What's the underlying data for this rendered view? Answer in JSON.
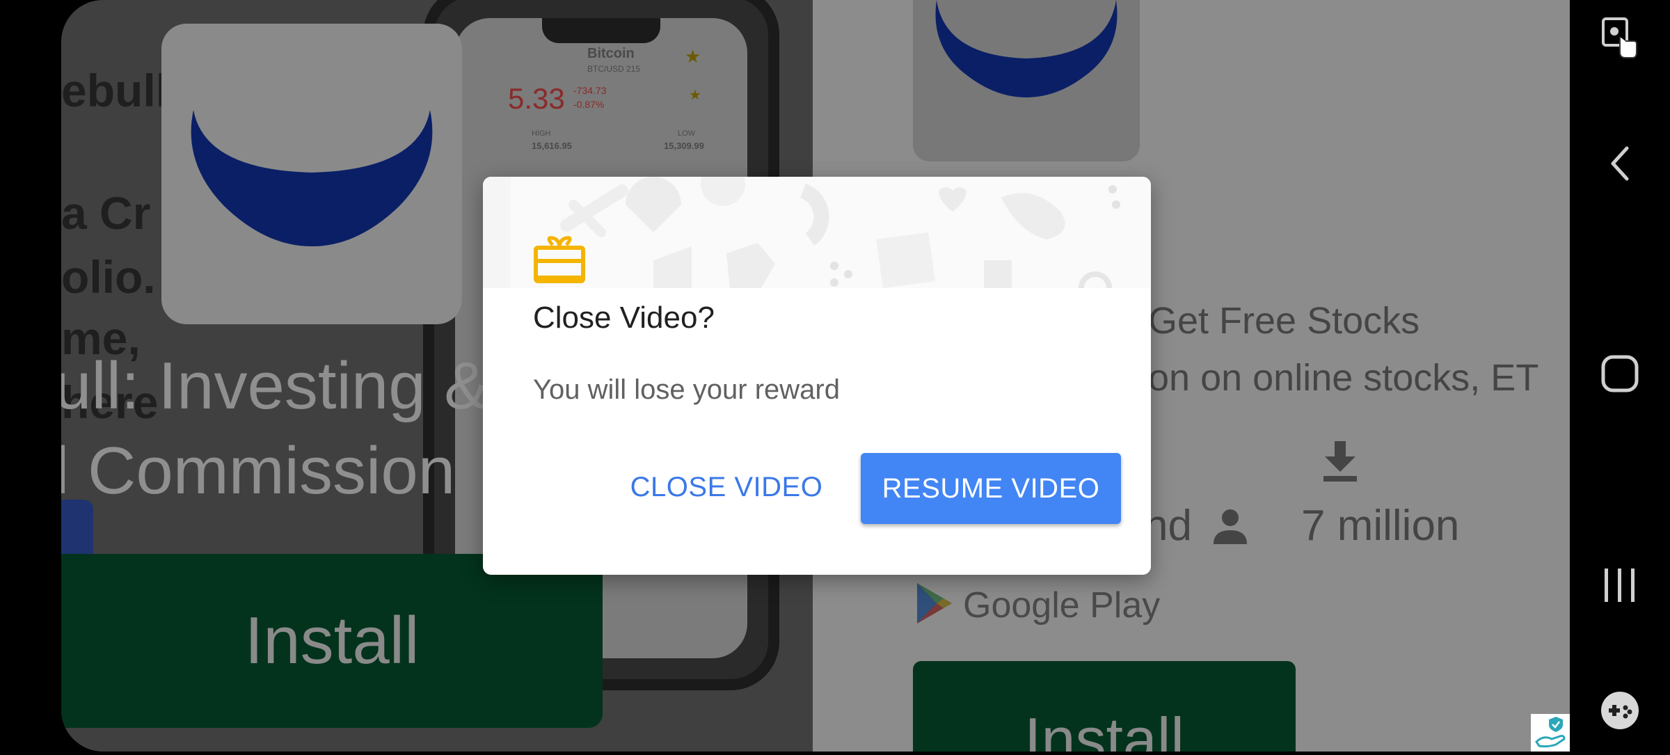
{
  "left_ad": {
    "bg_text_lines": [
      "ebull",
      "a Cr",
      "olio.",
      "me,",
      "here"
    ],
    "title_line1": "ull: Investing &",
    "title_line2": "l Commission",
    "install_label": "Install",
    "phone": {
      "coin_name": "Bitcoin",
      "coin_sub": "BTC/USD 215",
      "price": "5.33",
      "change_abs": "-734.73",
      "change_pct": "-0.87%",
      "high_label": "HIGH",
      "high_value": "15,616.95",
      "low_label": "LOW",
      "low_value": "15,309.99"
    }
  },
  "right_ad": {
    "subtitle": "Get Free Stocks",
    "description": "on on online stocks, ET",
    "rating_partial": "nd",
    "downloads": "7 million",
    "store_name": "Google Play",
    "install_label": "Install"
  },
  "dialog": {
    "title": "Close Video?",
    "message": "You will lose your reward",
    "close_label": "CLOSE VIDEO",
    "resume_label": "RESUME VIDEO",
    "gift_color": "#f4b400",
    "primary_color": "#4285f4"
  },
  "navbar": {
    "icons": [
      "key-touch-icon",
      "back-icon",
      "home-icon",
      "recents-icon",
      "game-tools-icon"
    ]
  }
}
